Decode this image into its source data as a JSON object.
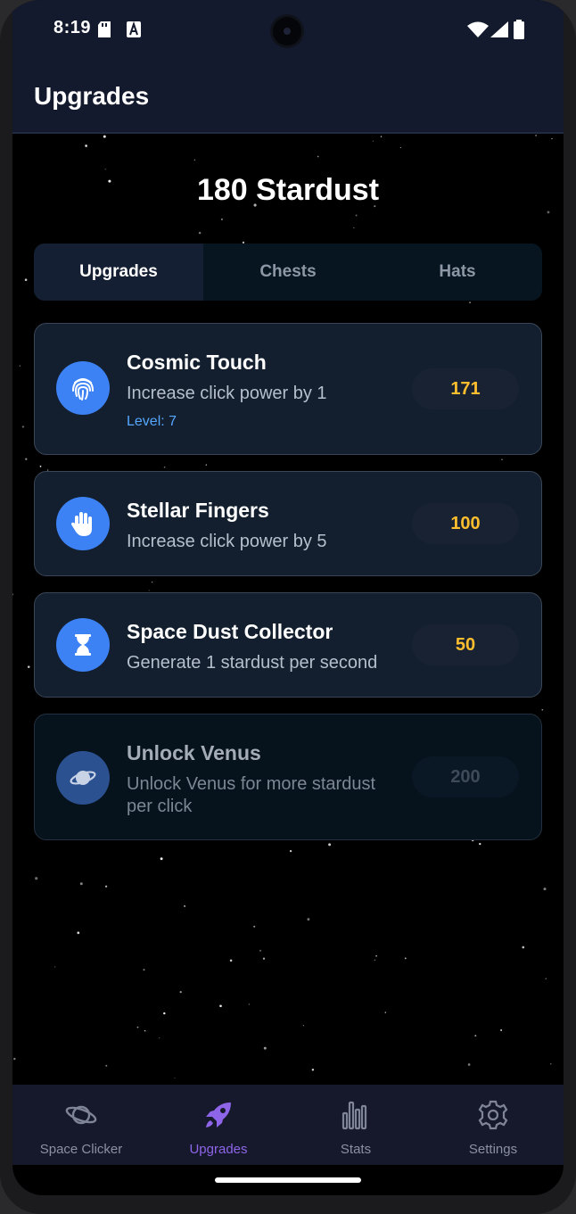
{
  "status": {
    "time": "8:19"
  },
  "appbar": {
    "title": "Upgrades"
  },
  "stardust": {
    "amount": "180",
    "unit": "Stardust"
  },
  "tabs": [
    {
      "label": "Upgrades",
      "active": true
    },
    {
      "label": "Chests",
      "active": false
    },
    {
      "label": "Hats",
      "active": false
    }
  ],
  "upgrades": [
    {
      "title": "Cosmic Touch",
      "description": "Increase click power by 1",
      "level": "Level: 7",
      "price": "171",
      "icon": "fingerprint-icon",
      "locked": false
    },
    {
      "title": "Stellar Fingers",
      "description": "Increase click power by 5",
      "price": "100",
      "icon": "hand-icon",
      "locked": false
    },
    {
      "title": "Space Dust Collector",
      "description": "Generate 1 stardust per second",
      "price": "50",
      "icon": "hourglass-icon",
      "locked": false
    },
    {
      "title": "Unlock Venus",
      "description": "Unlock Venus for more stardust per click",
      "price": "200",
      "icon": "planet-icon",
      "locked": true
    }
  ],
  "nav": [
    {
      "label": "Space Clicker",
      "icon": "planet-icon",
      "active": false
    },
    {
      "label": "Upgrades",
      "icon": "rocket-icon",
      "active": true
    },
    {
      "label": "Stats",
      "icon": "bar-chart-icon",
      "active": false
    },
    {
      "label": "Settings",
      "icon": "gear-icon",
      "active": false
    }
  ],
  "colors": {
    "accent": "#3c82f4",
    "price": "#ffbe2e",
    "nav_active": "#8e65e8",
    "level": "#55a7ff"
  }
}
